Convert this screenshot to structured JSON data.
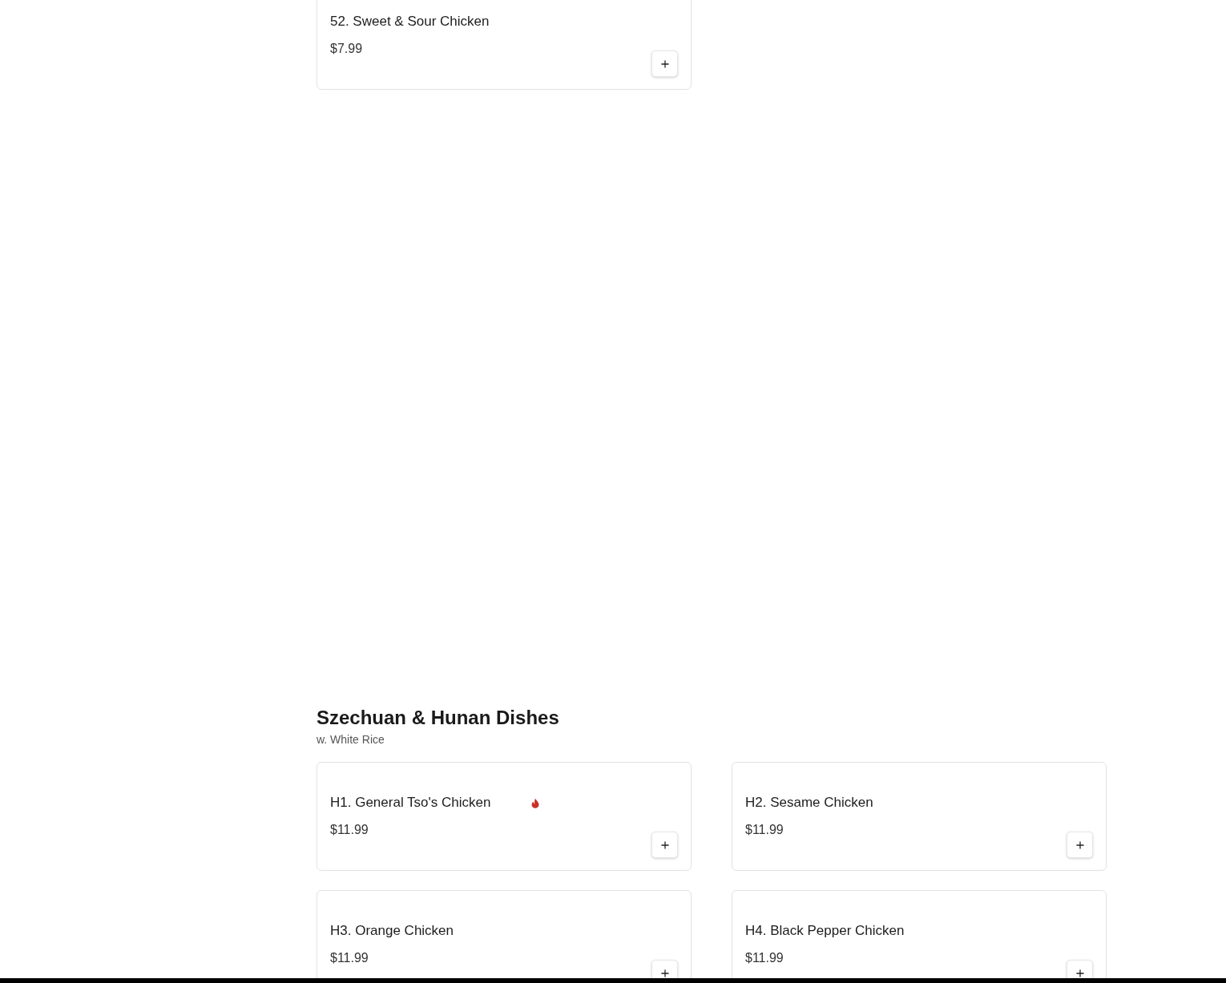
{
  "sections": [
    {
      "items": [
        {
          "name": "52. Sweet & Sour Chicken",
          "price": "$7.99",
          "spicy": false
        }
      ]
    },
    {
      "title": "Szechuan & Hunan Dishes",
      "subtitle": "w. White Rice",
      "items": [
        {
          "name": "H1. General Tso's Chicken",
          "price": "$11.99",
          "spicy": true
        },
        {
          "name": "H2. Sesame Chicken",
          "price": "$11.99",
          "spicy": false
        },
        {
          "name": "H3. Orange Chicken",
          "price": "$11.99",
          "spicy": false
        },
        {
          "name": "H4. Black Pepper Chicken",
          "price": "$11.99",
          "spicy": false
        }
      ]
    }
  ]
}
